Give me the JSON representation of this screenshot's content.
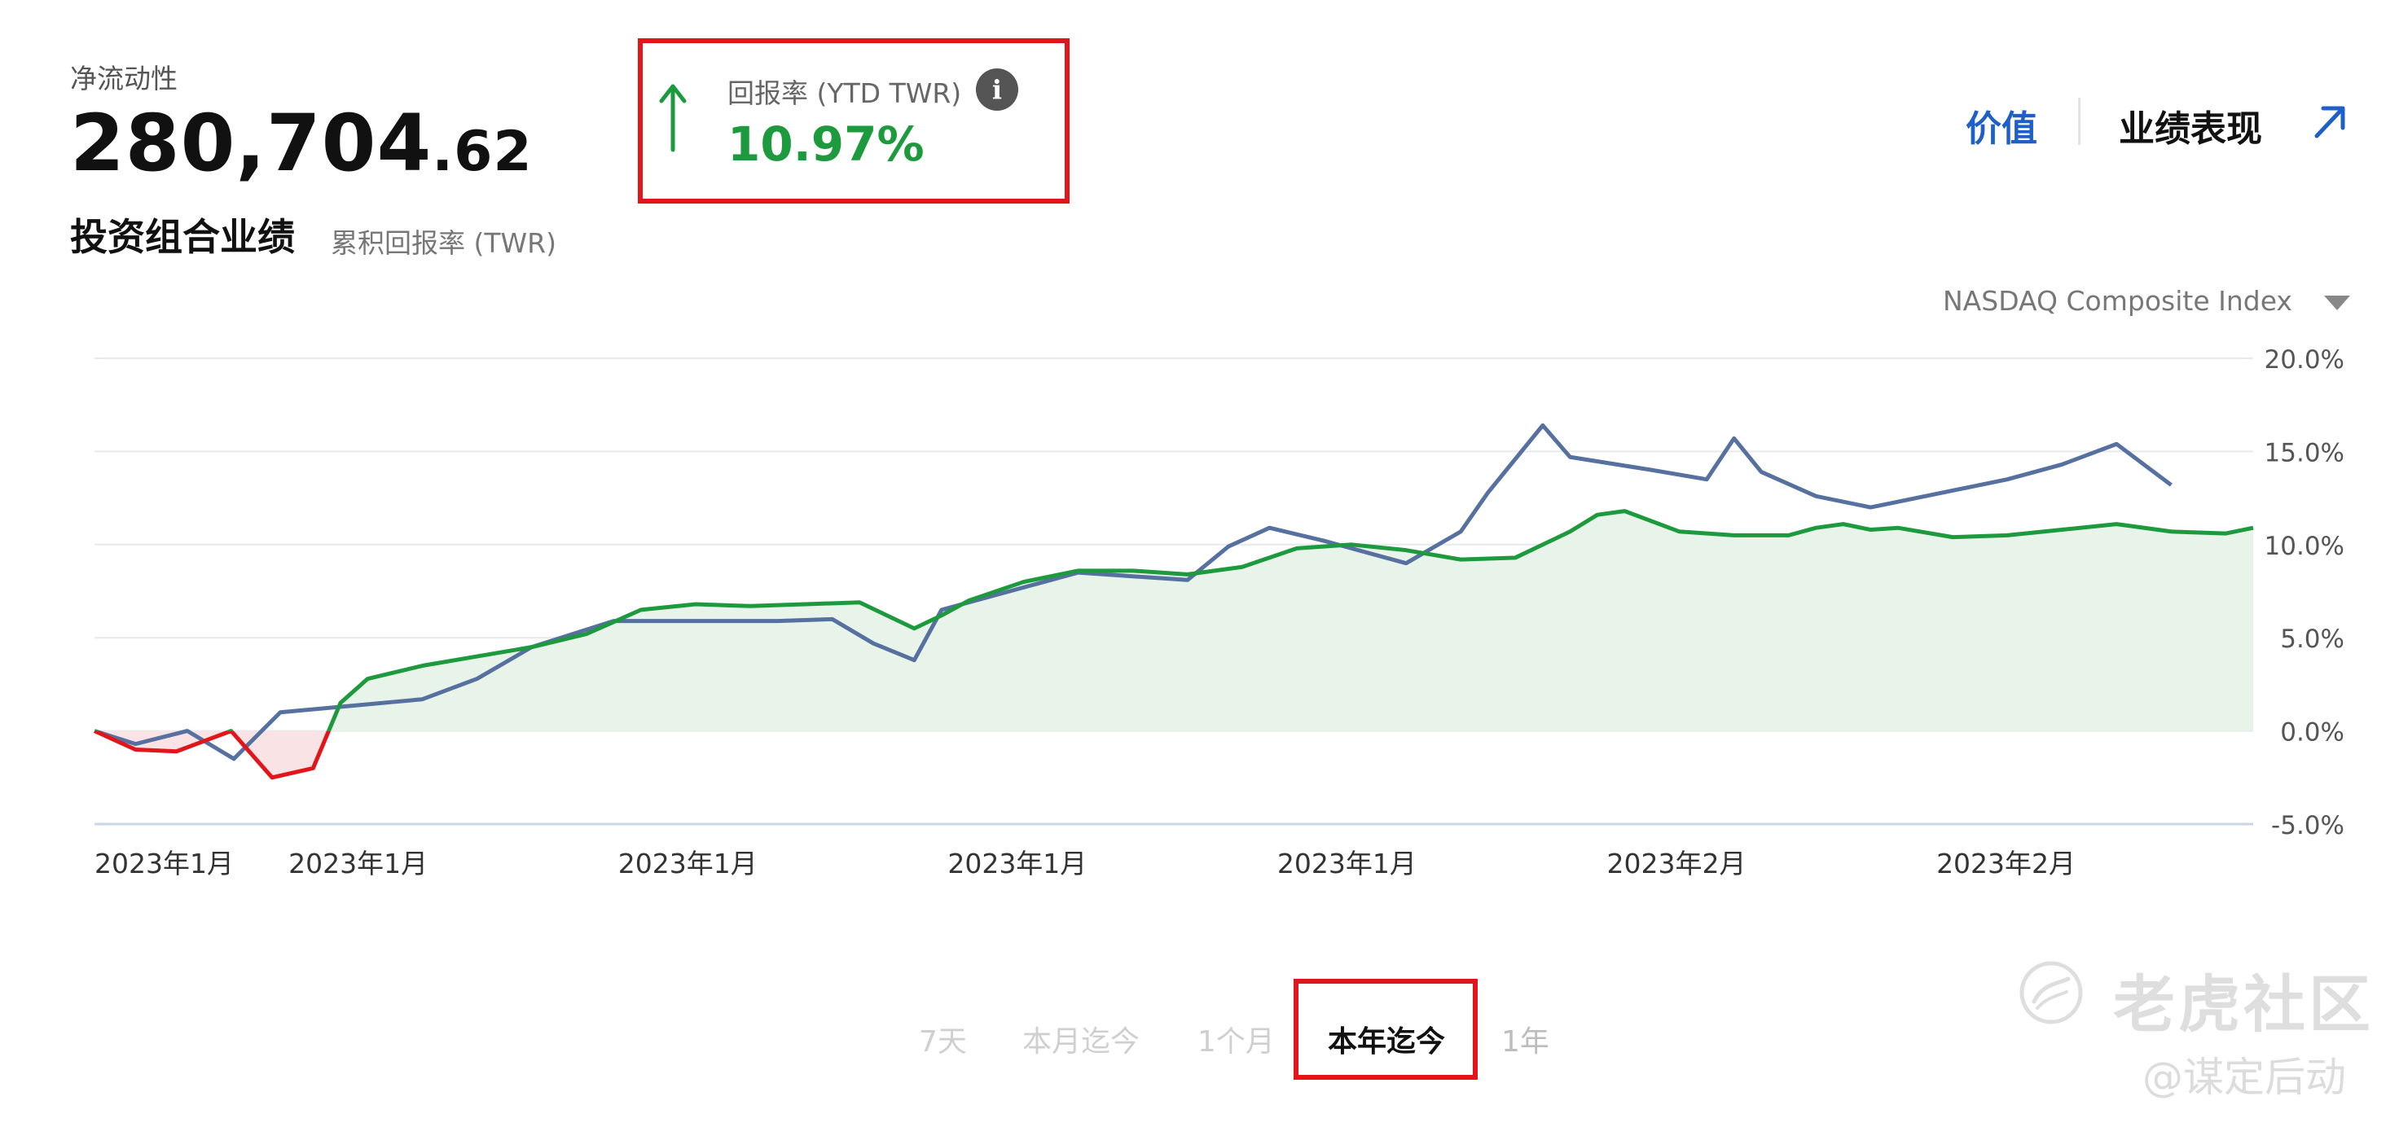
{
  "header": {
    "liquidity_label": "净流动性",
    "liquidity_int": "280,704",
    "liquidity_dec": ".62",
    "performance_title": "投资组合业绩",
    "performance_subtitle": "累积回报率 (TWR)"
  },
  "ytd_card": {
    "label": "回报率 (YTD TWR)",
    "value": "10.97%",
    "info_icon": "i",
    "arrow_color": "#1e9a3e"
  },
  "view_tabs": {
    "value_tab": "价值",
    "performance_tab": "业绩表现"
  },
  "benchmark": {
    "selected": "NASDAQ Composite Index"
  },
  "time_ranges": [
    "7天",
    "本月迄今",
    "1个月",
    "本年迄今",
    "1年"
  ],
  "watermark": {
    "brand": "老虎社区",
    "sub": "@谋定后动"
  },
  "colors": {
    "portfolio_positive": "#1e9a3e",
    "portfolio_negative": "#e2151b",
    "benchmark_line": "#5670a0",
    "accent_blue": "#1e60c8",
    "highlight_red": "#e2151b"
  },
  "chart_data": {
    "type": "line",
    "title": "",
    "xlabel": "",
    "ylabel": "",
    "ylim": [
      -5,
      20
    ],
    "y_ticks": [
      "20.0%",
      "15.0%",
      "10.0%",
      "5.0%",
      "0.0%",
      "-5.0%"
    ],
    "y_tick_values": [
      20,
      15,
      10,
      5,
      0,
      -5
    ],
    "x_tick_labels": [
      "2023年1月",
      "2023年1月",
      "2023年1月",
      "2023年1月",
      "2023年1月",
      "2023年2月",
      "2023年2月"
    ],
    "x_tick_index": [
      0,
      8,
      18,
      28,
      38,
      48,
      58
    ],
    "x_count": 66,
    "grid": true,
    "series": [
      {
        "role": "portfolio",
        "points": [
          [
            0,
            0
          ],
          [
            1.5,
            -1.0
          ],
          [
            3,
            -1.1
          ],
          [
            5,
            0
          ],
          [
            6.5,
            -2.5
          ],
          [
            8,
            -2.0
          ],
          [
            9,
            1.5
          ],
          [
            10,
            2.8
          ],
          [
            12,
            3.5
          ],
          [
            14,
            4.0
          ],
          [
            16,
            4.5
          ],
          [
            18,
            5.2
          ],
          [
            20,
            6.5
          ],
          [
            22,
            6.8
          ],
          [
            24,
            6.7
          ],
          [
            26,
            6.8
          ],
          [
            28,
            6.9
          ],
          [
            30,
            5.5
          ],
          [
            31,
            6.2
          ],
          [
            32,
            7.0
          ],
          [
            34,
            8.0
          ],
          [
            36,
            8.6
          ],
          [
            38,
            8.6
          ],
          [
            40,
            8.4
          ],
          [
            42,
            8.8
          ],
          [
            44,
            9.8
          ],
          [
            46,
            10.0
          ],
          [
            48,
            9.7
          ],
          [
            50,
            9.2
          ],
          [
            52,
            9.3
          ],
          [
            54,
            10.7
          ],
          [
            55,
            11.6
          ],
          [
            56,
            11.8
          ],
          [
            58,
            10.7
          ],
          [
            60,
            10.5
          ],
          [
            62,
            10.5
          ],
          [
            63,
            10.9
          ],
          [
            64,
            11.1
          ],
          [
            65,
            10.8
          ],
          [
            66,
            10.9
          ],
          [
            68,
            10.4
          ],
          [
            70,
            10.5
          ],
          [
            72,
            10.8
          ],
          [
            74,
            11.1
          ],
          [
            76,
            10.7
          ],
          [
            78,
            10.6
          ],
          [
            79,
            10.9
          ]
        ]
      },
      {
        "role": "benchmark",
        "points": [
          [
            0,
            0
          ],
          [
            1.5,
            -0.7
          ],
          [
            3.4,
            0
          ],
          [
            5.1,
            -1.5
          ],
          [
            6.8,
            1.0
          ],
          [
            12,
            1.7
          ],
          [
            14,
            2.8
          ],
          [
            16,
            4.5
          ],
          [
            19,
            5.9
          ],
          [
            25,
            5.9
          ],
          [
            27,
            6.0
          ],
          [
            28.5,
            4.7
          ],
          [
            30,
            3.8
          ],
          [
            31,
            6.5
          ],
          [
            36,
            8.5
          ],
          [
            38,
            8.3
          ],
          [
            40,
            8.1
          ],
          [
            41.5,
            9.9
          ],
          [
            43,
            10.9
          ],
          [
            45,
            10.2
          ],
          [
            48,
            9.0
          ],
          [
            50,
            10.7
          ],
          [
            51,
            12.8
          ],
          [
            53,
            16.4
          ],
          [
            54,
            14.7
          ],
          [
            57,
            14.0
          ],
          [
            59,
            13.5
          ],
          [
            60,
            15.7
          ],
          [
            61,
            13.9
          ],
          [
            63,
            12.6
          ],
          [
            65,
            12.0
          ],
          [
            70,
            13.5
          ],
          [
            72,
            14.3
          ],
          [
            74,
            15.4
          ],
          [
            76,
            13.2
          ]
        ]
      }
    ]
  }
}
